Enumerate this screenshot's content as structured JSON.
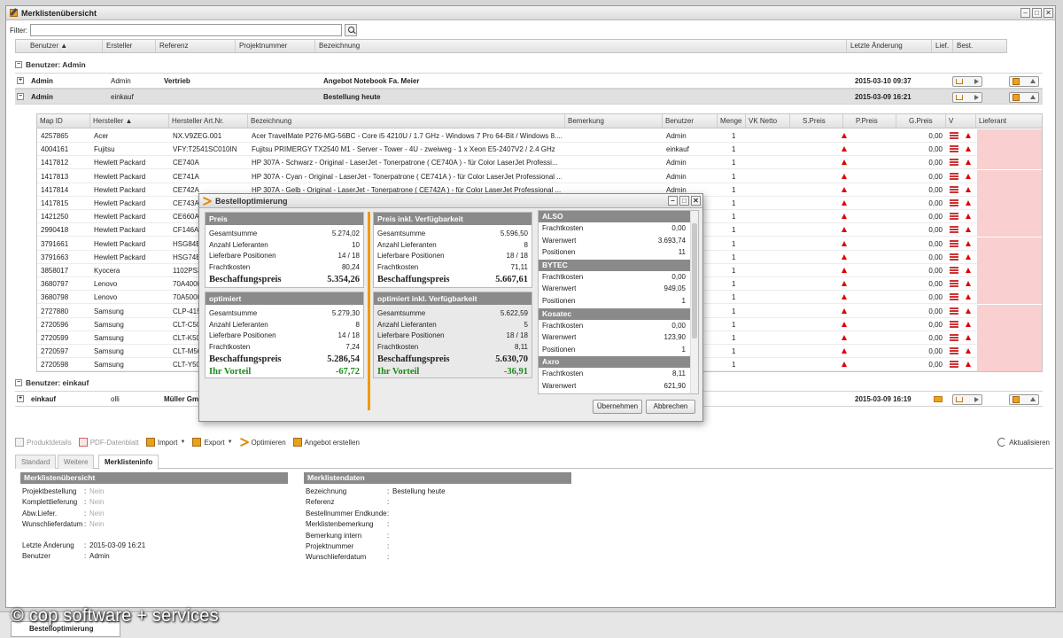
{
  "window": {
    "title": "Merklistenübersicht"
  },
  "filter": {
    "label": "Filter:",
    "value": ""
  },
  "main_columns": [
    "Benutzer ▲",
    "Ersteller",
    "Referenz",
    "Projektnummer",
    "Bezeichnung",
    "Letzte Änderung",
    "Lief.",
    "Best."
  ],
  "groups": [
    {
      "label": "Benutzer: Admin"
    },
    {
      "label": "Benutzer: einkauf"
    }
  ],
  "lists": [
    {
      "toggle": "+",
      "benutzer": "Admin",
      "ersteller": "Admin",
      "referenz": "Vertrieb",
      "bezeichnung": "Angebot Notebook Fa. Meier",
      "datum": "2015-03-10 09:37"
    },
    {
      "toggle": "−",
      "benutzer": "Admin",
      "ersteller": "einkauf",
      "referenz": "",
      "bezeichnung": "Bestellung heute",
      "datum": "2015-03-09 16:21"
    },
    {
      "toggle": "+",
      "benutzer": "einkauf",
      "ersteller": "olli",
      "referenz": "Müller Gmbh",
      "bezeichnung": "",
      "datum": "2015-03-09 16:19"
    }
  ],
  "inner_columns": [
    "Map ID",
    "Hersteller ▲",
    "Hersteller Art.Nr.",
    "Bezeichnung",
    "Bemerkung",
    "Benutzer",
    "Menge",
    "VK Netto",
    "S.Preis",
    "P.Preis",
    "G.Preis",
    "V",
    "Lieferant"
  ],
  "inner_rows": [
    {
      "id": "4257865",
      "hersteller": "Acer",
      "artnr": "NX.V9ZEG.001",
      "bez": "Acer TravelMate P276-MG-56BC - Core i5 4210U / 1.7 GHz - Windows 7 Pro 64-Bit / Windows 8....",
      "benutzer": "Admin",
      "menge": "1",
      "gpreis": "0,00"
    },
    {
      "id": "4004161",
      "hersteller": "Fujitsu",
      "artnr": "VFY:T2541SC010IN",
      "bez": "Fujitsu PRIMERGY TX2540 M1 - Server - Tower - 4U - zweiweg - 1 x Xeon E5-2407V2 / 2.4 GHz",
      "benutzer": "einkauf",
      "menge": "1",
      "gpreis": "0,00"
    },
    {
      "id": "1417812",
      "hersteller": "Hewlett Packard",
      "artnr": "CE740A",
      "bez": "HP 307A - Schwarz - Original - LaserJet - Tonerpatrone ( CE740A ) - für Color LaserJet Professi...",
      "benutzer": "Admin",
      "menge": "1",
      "gpreis": "0,00"
    },
    {
      "id": "1417813",
      "hersteller": "Hewlett Packard",
      "artnr": "CE741A",
      "bez": "HP 307A - Cyan - Original - LaserJet - Tonerpatrone ( CE741A ) - für Color LaserJet Professional ...",
      "benutzer": "Admin",
      "menge": "1",
      "gpreis": "0,00"
    },
    {
      "id": "1417814",
      "hersteller": "Hewlett Packard",
      "artnr": "CE742A",
      "bez": "HP 307A - Gelb - Original - LaserJet - Tonerpatrone ( CE742A ) - für Color LaserJet Professional ...",
      "benutzer": "Admin",
      "menge": "1",
      "gpreis": "0,00"
    },
    {
      "id": "1417815",
      "hersteller": "Hewlett Packard",
      "artnr": "CE743A",
      "bez": "",
      "benutzer": "",
      "menge": "1",
      "gpreis": "0,00"
    },
    {
      "id": "1421250",
      "hersteller": "Hewlett Packard",
      "artnr": "CE660A",
      "bez": "",
      "benutzer": "",
      "menge": "1",
      "gpreis": "0,00"
    },
    {
      "id": "2990418",
      "hersteller": "Hewlett Packard",
      "artnr": "CF146A",
      "bez": "",
      "benutzer": "",
      "menge": "1",
      "gpreis": "0,00"
    },
    {
      "id": "3791661",
      "hersteller": "Hewlett Packard",
      "artnr": "HSG84E",
      "bez": "",
      "benutzer": "",
      "menge": "1",
      "gpreis": "0,00"
    },
    {
      "id": "3791663",
      "hersteller": "Hewlett Packard",
      "artnr": "HSG74E",
      "bez": "",
      "benutzer": "",
      "menge": "1",
      "gpreis": "0,00"
    },
    {
      "id": "3858017",
      "hersteller": "Kyocera",
      "artnr": "1102PS3",
      "bez": "",
      "benutzer": "",
      "menge": "1",
      "gpreis": "0,00"
    },
    {
      "id": "3680797",
      "hersteller": "Lenovo",
      "artnr": "70A4000",
      "bez": "",
      "benutzer": "",
      "menge": "1",
      "gpreis": "0,00"
    },
    {
      "id": "3680798",
      "hersteller": "Lenovo",
      "artnr": "70A5000",
      "bez": "",
      "benutzer": "",
      "menge": "1",
      "gpreis": "0,00"
    },
    {
      "id": "2727880",
      "hersteller": "Samsung",
      "artnr": "CLP-415",
      "bez": "",
      "benutzer": "",
      "menge": "1",
      "gpreis": "0,00"
    },
    {
      "id": "2720596",
      "hersteller": "Samsung",
      "artnr": "CLT-C50",
      "bez": "",
      "benutzer": "",
      "menge": "1",
      "gpreis": "0,00"
    },
    {
      "id": "2720599",
      "hersteller": "Samsung",
      "artnr": "CLT-K50",
      "bez": "",
      "benutzer": "",
      "menge": "1",
      "gpreis": "0,00"
    },
    {
      "id": "2720597",
      "hersteller": "Samsung",
      "artnr": "CLT-M50",
      "bez": "",
      "benutzer": "",
      "menge": "1",
      "gpreis": "0,00"
    },
    {
      "id": "2720598",
      "hersteller": "Samsung",
      "artnr": "CLT-Y50",
      "bez": "",
      "benutzer": "",
      "menge": "1",
      "gpreis": "0,00"
    }
  ],
  "dialog": {
    "title": "Bestelloptimierung",
    "preis": {
      "title": "Preis",
      "rows": [
        [
          "Gesamtsumme",
          "5.274,02"
        ],
        [
          "Anzahl Lieferanten",
          "10"
        ],
        [
          "Lieferbare Positionen",
          "14 / 18"
        ],
        [
          "Frachtkosten",
          "80,24"
        ]
      ],
      "total_label": "Beschaffungspreis",
      "total": "5.354,26"
    },
    "optimiert": {
      "title": "optimiert",
      "rows": [
        [
          "Gesamtsumme",
          "5.279,30"
        ],
        [
          "Anzahl Lieferanten",
          "8"
        ],
        [
          "Lieferbare Positionen",
          "14 / 18"
        ],
        [
          "Frachtkosten",
          "7,24"
        ]
      ],
      "total_label": "Beschaffungspreis",
      "total": "5.286,54",
      "vorteil_label": "Ihr Vorteil",
      "vorteil": "-67,72"
    },
    "preis_verf": {
      "title": "Preis inkl. Verfügbarkeit",
      "rows": [
        [
          "Gesamtsumme",
          "5.596,50"
        ],
        [
          "Anzahl Lieferanten",
          "8"
        ],
        [
          "Lieferbare Positionen",
          "18 / 18"
        ],
        [
          "Frachtkosten",
          "71,11"
        ]
      ],
      "total_label": "Beschaffungspreis",
      "total": "5.667,61"
    },
    "optimiert_verf": {
      "title": "optimiert inkl. Verfügbarkeit",
      "rows": [
        [
          "Gesamtsumme",
          "5.622,59"
        ],
        [
          "Anzahl Lieferanten",
          "5"
        ],
        [
          "Lieferbare Positionen",
          "18 / 18"
        ],
        [
          "Frachtkosten",
          "8,11"
        ]
      ],
      "total_label": "Beschaffungspreis",
      "total": "5.630,70",
      "vorteil_label": "Ihr Vorteil",
      "vorteil": "-36,91"
    },
    "suppliers": [
      {
        "name": "ALSO",
        "rows": [
          [
            "Frachtkosten",
            "0,00"
          ],
          [
            "Warenwert",
            "3.693,74"
          ],
          [
            "Positionen",
            "11"
          ]
        ]
      },
      {
        "name": "BYTEC",
        "rows": [
          [
            "Frachtkosten",
            "0,00"
          ],
          [
            "Warenwert",
            "949,05"
          ],
          [
            "Positionen",
            "1"
          ]
        ]
      },
      {
        "name": "Kosatec",
        "rows": [
          [
            "Frachtkosten",
            "0,00"
          ],
          [
            "Warenwert",
            "123,90"
          ],
          [
            "Positionen",
            "1"
          ]
        ]
      },
      {
        "name": "Axro",
        "rows": [
          [
            "Frachtkosten",
            "8,11"
          ],
          [
            "Warenwert",
            "621,90"
          ]
        ]
      }
    ],
    "btn_ok": "Übernehmen",
    "btn_cancel": "Abbrechen"
  },
  "toolbar": {
    "produktdetails": "Produktdetails",
    "pdf": "PDF-Datenblatt",
    "import": "Import",
    "export": "Export",
    "optimieren": "Optimieren",
    "angebot": "Angebot erstellen",
    "aktualisieren": "Aktualisieren"
  },
  "tabs": [
    "Standard",
    "Weitere",
    "Merklisteninfo"
  ],
  "info_left": {
    "title": "Merklistenübersicht",
    "rows": [
      [
        "Projektbestellung",
        "Nein"
      ],
      [
        "Komplettlieferung",
        "Nein"
      ],
      [
        "Abw.Liefer.",
        "Nein"
      ],
      [
        "Wunschlieferdatum",
        "Nein"
      ]
    ],
    "rows2": [
      [
        "Letzte Änderung",
        "2015-03-09 16:21"
      ],
      [
        "Benutzer",
        "Admin"
      ]
    ]
  },
  "info_right": {
    "title": "Merklistendaten",
    "rows": [
      [
        "Bezeichnung",
        "Bestellung heute"
      ],
      [
        "Referenz",
        ""
      ],
      [
        "Bestellnummer Endkunde",
        ""
      ],
      [
        "Merklistenbemerkung",
        ""
      ],
      [
        "Bemerkung intern",
        ""
      ],
      [
        "Projektnummer",
        ""
      ],
      [
        "Wunschlieferdatum",
        ""
      ]
    ]
  },
  "taskbar": {
    "label": "Bestelloptimierung"
  },
  "watermark": "© cop software + services"
}
